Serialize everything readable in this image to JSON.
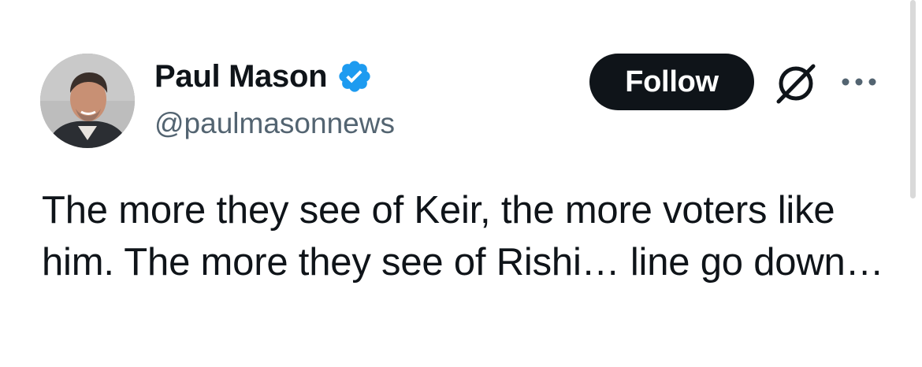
{
  "author": {
    "display_name": "Paul Mason",
    "handle": "@paulmasonnews",
    "verified": true
  },
  "actions": {
    "follow_label": "Follow"
  },
  "tweet": {
    "text": "The more they see of Keir, the more voters like him. The more they see of Rishi… line go down…"
  },
  "icons": {
    "verified": "verified-badge-icon",
    "grok": "grok-icon",
    "more": "more-options-icon"
  },
  "colors": {
    "text": "#0f1419",
    "secondary_text": "#536471",
    "verified_blue": "#1d9bf0",
    "follow_button_bg": "#0f1419",
    "follow_button_text": "#ffffff"
  }
}
